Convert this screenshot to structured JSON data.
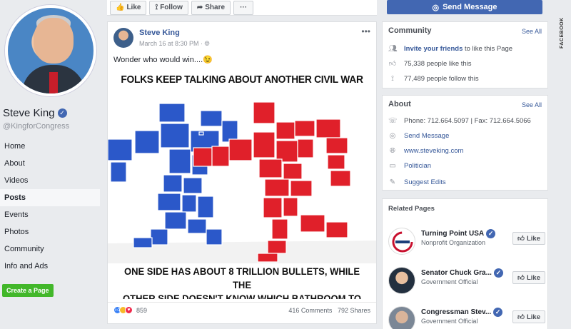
{
  "page": {
    "name": "Steve King",
    "handle": "@KingforCongress"
  },
  "nav": {
    "items": [
      "Home",
      "About",
      "Videos",
      "Posts",
      "Events",
      "Photos",
      "Community",
      "Info and Ads"
    ],
    "active": "Posts",
    "create_page": "Create a Page"
  },
  "topbar": {
    "like": "Like",
    "follow": "Follow",
    "share": "Share",
    "more": "···"
  },
  "post": {
    "author": "Steve King",
    "time": "March 16 at 8:30 PM · ",
    "text": "Wonder who would win....",
    "emoji": "😉",
    "menu": "•••",
    "meme_top": "FOLKS KEEP TALKING ABOUT ANOTHER CIVIL WAR",
    "meme_bottom_1": "ONE SIDE HAS ABOUT 8 TRILLION BULLETS, WHILE THE",
    "meme_bottom_2": "OTHER SIDE DOESN'T KNOW WHICH BATHROOM TO USE",
    "reaction_count": "859",
    "comments": "416 Comments",
    "shares": "792 Shares",
    "colors": {
      "blue": "#2b58c9",
      "red": "#e0202a"
    }
  },
  "right": {
    "send_message": "Send Message",
    "community": {
      "title": "Community",
      "see_all": "See All",
      "invite_link": "Invite your friends",
      "invite_rest": " to like this Page",
      "likes": "75,338 people like this",
      "follows": "77,489 people follow this"
    },
    "about": {
      "title": "About",
      "see_all": "See All",
      "phone": "Phone: 712.664.5097 | Fax: 712.664.5066",
      "send_message": "Send Message",
      "website": "www.steveking.com",
      "category": "Politician",
      "suggest": "Suggest Edits"
    },
    "related": {
      "title": "Related Pages",
      "items": [
        {
          "name": "Turning Point USA",
          "sub": "Nonprofit Organization",
          "like": "Like"
        },
        {
          "name": "Senator Chuck Gra...",
          "sub": "Government Official",
          "like": "Like"
        },
        {
          "name": "Congressman Stev...",
          "sub": "Government Official",
          "like": "Like"
        }
      ]
    }
  },
  "source_tag": "FACEBOOK"
}
